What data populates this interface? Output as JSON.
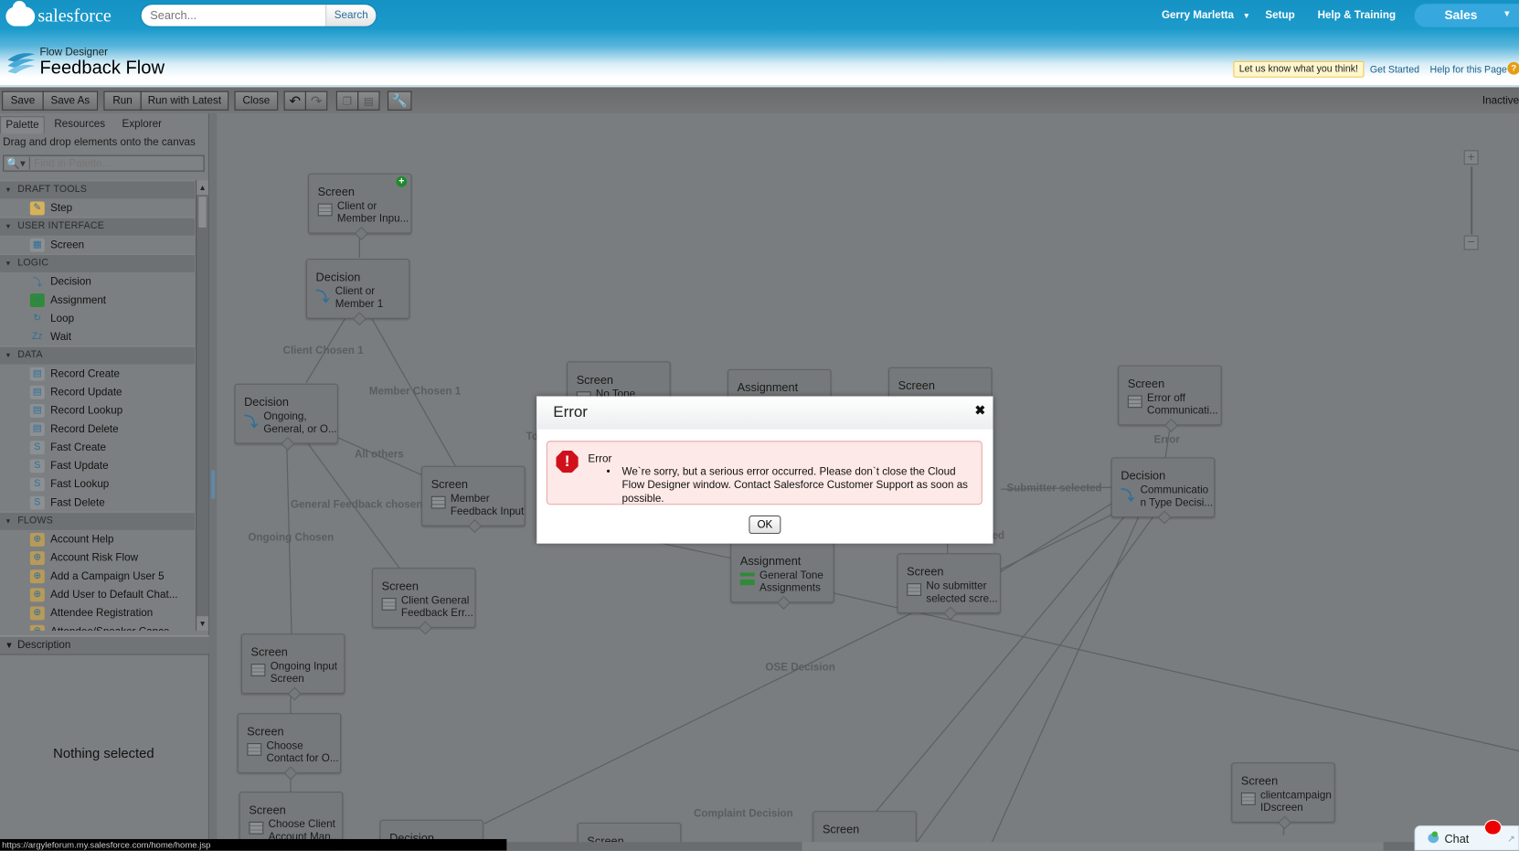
{
  "header": {
    "logo_text": "salesforce",
    "search_placeholder": "Search...",
    "search_button": "Search",
    "user_menu": "Gerry Marletta",
    "setup": "Setup",
    "help_training": "Help & Training",
    "app_switcher": "Sales",
    "subtitle": "Flow Designer",
    "title": "Feedback Flow",
    "feedback_link": "Let us know what you think!",
    "get_started": "Get Started",
    "help_page": "Help for this Page"
  },
  "toolbar": {
    "save": "Save",
    "save_as": "Save As",
    "run": "Run",
    "run_latest": "Run with Latest",
    "close": "Close",
    "status": "Inactive"
  },
  "sidebar": {
    "tabs": [
      "Palette",
      "Resources",
      "Explorer"
    ],
    "hint": "Drag and drop elements onto the canvas",
    "search_placeholder": "Find in Palette...",
    "sections": [
      {
        "title": "DRAFT TOOLS",
        "items": [
          "Step"
        ]
      },
      {
        "title": "USER INTERFACE",
        "items": [
          "Screen"
        ]
      },
      {
        "title": "LOGIC",
        "items": [
          "Decision",
          "Assignment",
          "Loop",
          "Wait"
        ]
      },
      {
        "title": "DATA",
        "items": [
          "Record Create",
          "Record Update",
          "Record Lookup",
          "Record Delete",
          "Fast Create",
          "Fast Update",
          "Fast Lookup",
          "Fast Delete"
        ]
      },
      {
        "title": "FLOWS",
        "items": [
          "Account Help",
          "Account Risk Flow",
          "Add a Campaign User 5",
          "Add User to Default Chat...",
          "Attendee Registration",
          "Attendee/Speaker Cance..."
        ]
      }
    ],
    "description_header": "Description",
    "nothing_selected": "Nothing selected"
  },
  "canvas": {
    "nodes": [
      {
        "type": "Screen",
        "label": "Client or\nMember Inpu..."
      },
      {
        "type": "Decision",
        "label": "Client or\nMember 1"
      },
      {
        "type": "Decision",
        "label": "Ongoing,\nGeneral, or O..."
      },
      {
        "type": "Screen",
        "label": "Member\nFeedback Input"
      },
      {
        "type": "Screen",
        "label": "No Tone"
      },
      {
        "type": "Assignment",
        "label": ""
      },
      {
        "type": "Screen",
        "label": ""
      },
      {
        "type": "Screen",
        "label": "Error off\nCommunicati..."
      },
      {
        "type": "Decision",
        "label": "Communicatio\nn Type Decisi..."
      },
      {
        "type": "Assignment",
        "label": "General Tone\nAssignments"
      },
      {
        "type": "Screen",
        "label": "No submitter\nselected scre..."
      },
      {
        "type": "Screen",
        "label": "Client General\nFeedback Err..."
      },
      {
        "type": "Screen",
        "label": "Ongoing Input\nScreen"
      },
      {
        "type": "Screen",
        "label": "Choose\nContact for O..."
      },
      {
        "type": "Screen",
        "label": "Choose Client\nAccount Man..."
      },
      {
        "type": "Decision",
        "label": ""
      },
      {
        "type": "Screen",
        "label": ""
      },
      {
        "type": "Screen",
        "label": ""
      },
      {
        "type": "Screen",
        "label": "clientcampaign\nIDscreen"
      }
    ],
    "edge_labels": [
      "Client Chosen 1",
      "Member Chosen 1",
      "All others",
      "General Feedback chosen",
      "Ongoing Chosen",
      "Submitter selected",
      "Error",
      "OSE Decision",
      "Complaint Decision",
      "To",
      "ed"
    ]
  },
  "modal": {
    "title": "Error",
    "alert_heading": "Error",
    "message": "We`re sorry, but a serious error occurred. Please don`t close the Cloud Flow Designer window. Contact Salesforce Customer Support as soon as possible.",
    "ok": "OK"
  },
  "status_bar": "https://argyleforum.my.salesforce.com/home/home.jsp",
  "chat": "Chat",
  "colors": {
    "brand": "#1592c4",
    "error": "#d0111c",
    "alert_bg": "#fde9e7"
  }
}
